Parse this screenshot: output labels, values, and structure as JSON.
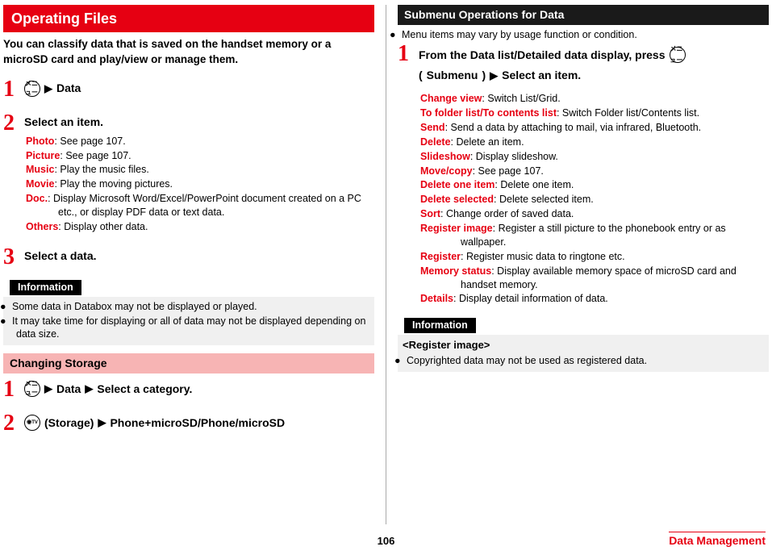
{
  "left": {
    "title": "Operating Files",
    "intro": "You can classify data that is saved on the handset memory or a microSD card and play/view or manage them.",
    "steps": [
      {
        "num": "1",
        "icon": "メニュー",
        "after": "Data"
      },
      {
        "num": "2",
        "title": "Select an item.",
        "defs": [
          {
            "term": "Photo",
            "desc": ": See page 107."
          },
          {
            "term": "Picture",
            "desc": ": See page 107."
          },
          {
            "term": "Music",
            "desc": ": Play the music files."
          },
          {
            "term": "Movie",
            "desc": ": Play the moving pictures."
          },
          {
            "term": "Doc.",
            "desc": ": Display Microsoft Word/Excel/PowerPoint document created on a PC etc., or display PDF data or text data."
          },
          {
            "term": "Others",
            "desc": ": Display other data."
          }
        ]
      },
      {
        "num": "3",
        "title": "Select a data."
      }
    ],
    "info_label": "Information",
    "info_bullets": [
      "Some data in Databox may not be displayed or played.",
      "It may take time for displaying or all of data may not be displayed depending on data size."
    ],
    "section2": {
      "title": "Changing Storage",
      "steps": [
        {
          "num": "1",
          "icon": "メニュー",
          "parts": [
            "Data",
            "Select a category."
          ]
        },
        {
          "num": "2",
          "icon": "◉TV",
          "label": "(Storage)",
          "after": "Phone+microSD/Phone/microSD"
        }
      ]
    }
  },
  "right": {
    "title": "Submenu Operations for Data",
    "note": "Menu items may vary by usage function or condition.",
    "step": {
      "num": "1",
      "line1a": "From the Data list/Detailed data display, press",
      "icon": "メニュー",
      "line2a": "(",
      "line2b": "Submenu",
      "line2c": ")",
      "after": "Select an item."
    },
    "defs": [
      {
        "term": "Change view",
        "desc": ": Switch List/Grid."
      },
      {
        "term": "To folder list/To contents list",
        "desc": ": Switch Folder list/Contents list."
      },
      {
        "term": "Send",
        "desc": ": Send a data by attaching to mail, via infrared, Bluetooth."
      },
      {
        "term": "Delete",
        "desc": ": Delete an item."
      },
      {
        "term": "Slideshow",
        "desc": ": Display slideshow."
      },
      {
        "term": "Move/copy",
        "desc": ": See page 107."
      },
      {
        "term": "Delete one item",
        "desc": ": Delete one item."
      },
      {
        "term": "Delete selected",
        "desc": ": Delete selected item."
      },
      {
        "term": "Sort",
        "desc": ": Change order of saved data."
      },
      {
        "term": "Register image",
        "desc": ": Register a still picture to the phonebook entry or as wallpaper."
      },
      {
        "term": "Register",
        "desc": ": Register music data to ringtone etc."
      },
      {
        "term": "Memory status",
        "desc": ": Display available memory space of microSD card and handset memory."
      },
      {
        "term": "Details",
        "desc": ": Display detail information of data."
      }
    ],
    "info_label": "Information",
    "info_heading": "<Register image>",
    "info_bullets": [
      "Copyrighted data may not be used as registered data."
    ]
  },
  "footer": {
    "page": "106",
    "section": "Data Management"
  }
}
